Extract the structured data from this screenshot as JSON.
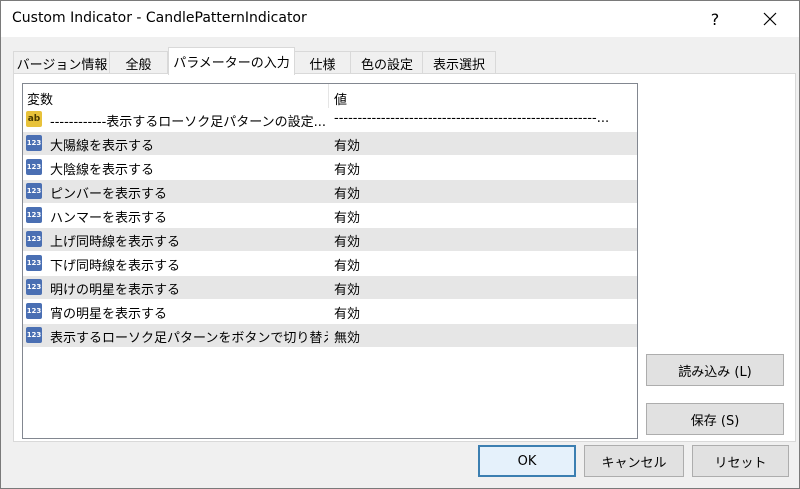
{
  "window": {
    "title": "Custom Indicator - CandlePatternIndicator",
    "help_label": "?"
  },
  "tabs": [
    {
      "label": "バージョン情報"
    },
    {
      "label": "全般"
    },
    {
      "label": "パラメーターの入力"
    },
    {
      "label": "仕様"
    },
    {
      "label": "色の設定"
    },
    {
      "label": "表示選択"
    }
  ],
  "grid": {
    "columns": {
      "name": "変数",
      "value": "値"
    },
    "rows": [
      {
        "name": "------------表示するローソク足パターンの設定...",
        "value": "--------------------------------------------------------...",
        "icon": "string-icon"
      },
      {
        "name": "大陽線を表示する",
        "value": "有効",
        "icon": "integer-icon"
      },
      {
        "name": "大陰線を表示する",
        "value": "有効",
        "icon": "integer-icon"
      },
      {
        "name": "ピンバーを表示する",
        "value": "有効",
        "icon": "integer-icon"
      },
      {
        "name": "ハンマーを表示する",
        "value": "有効",
        "icon": "integer-icon"
      },
      {
        "name": "上げ同時線を表示する",
        "value": "有効",
        "icon": "integer-icon"
      },
      {
        "name": "下げ同時線を表示する",
        "value": "有効",
        "icon": "integer-icon"
      },
      {
        "name": "明けの明星を表示する",
        "value": "有効",
        "icon": "integer-icon"
      },
      {
        "name": "宵の明星を表示する",
        "value": "有効",
        "icon": "integer-icon"
      },
      {
        "name": "表示するローソク足パターンをボタンで切り替え・..",
        "value": "無効",
        "icon": "integer-icon"
      }
    ]
  },
  "side_buttons": {
    "load": "読み込み (L)",
    "save": "保存 (S)"
  },
  "footer": {
    "ok": "OK",
    "cancel": "キャンセル",
    "reset": "リセット"
  }
}
